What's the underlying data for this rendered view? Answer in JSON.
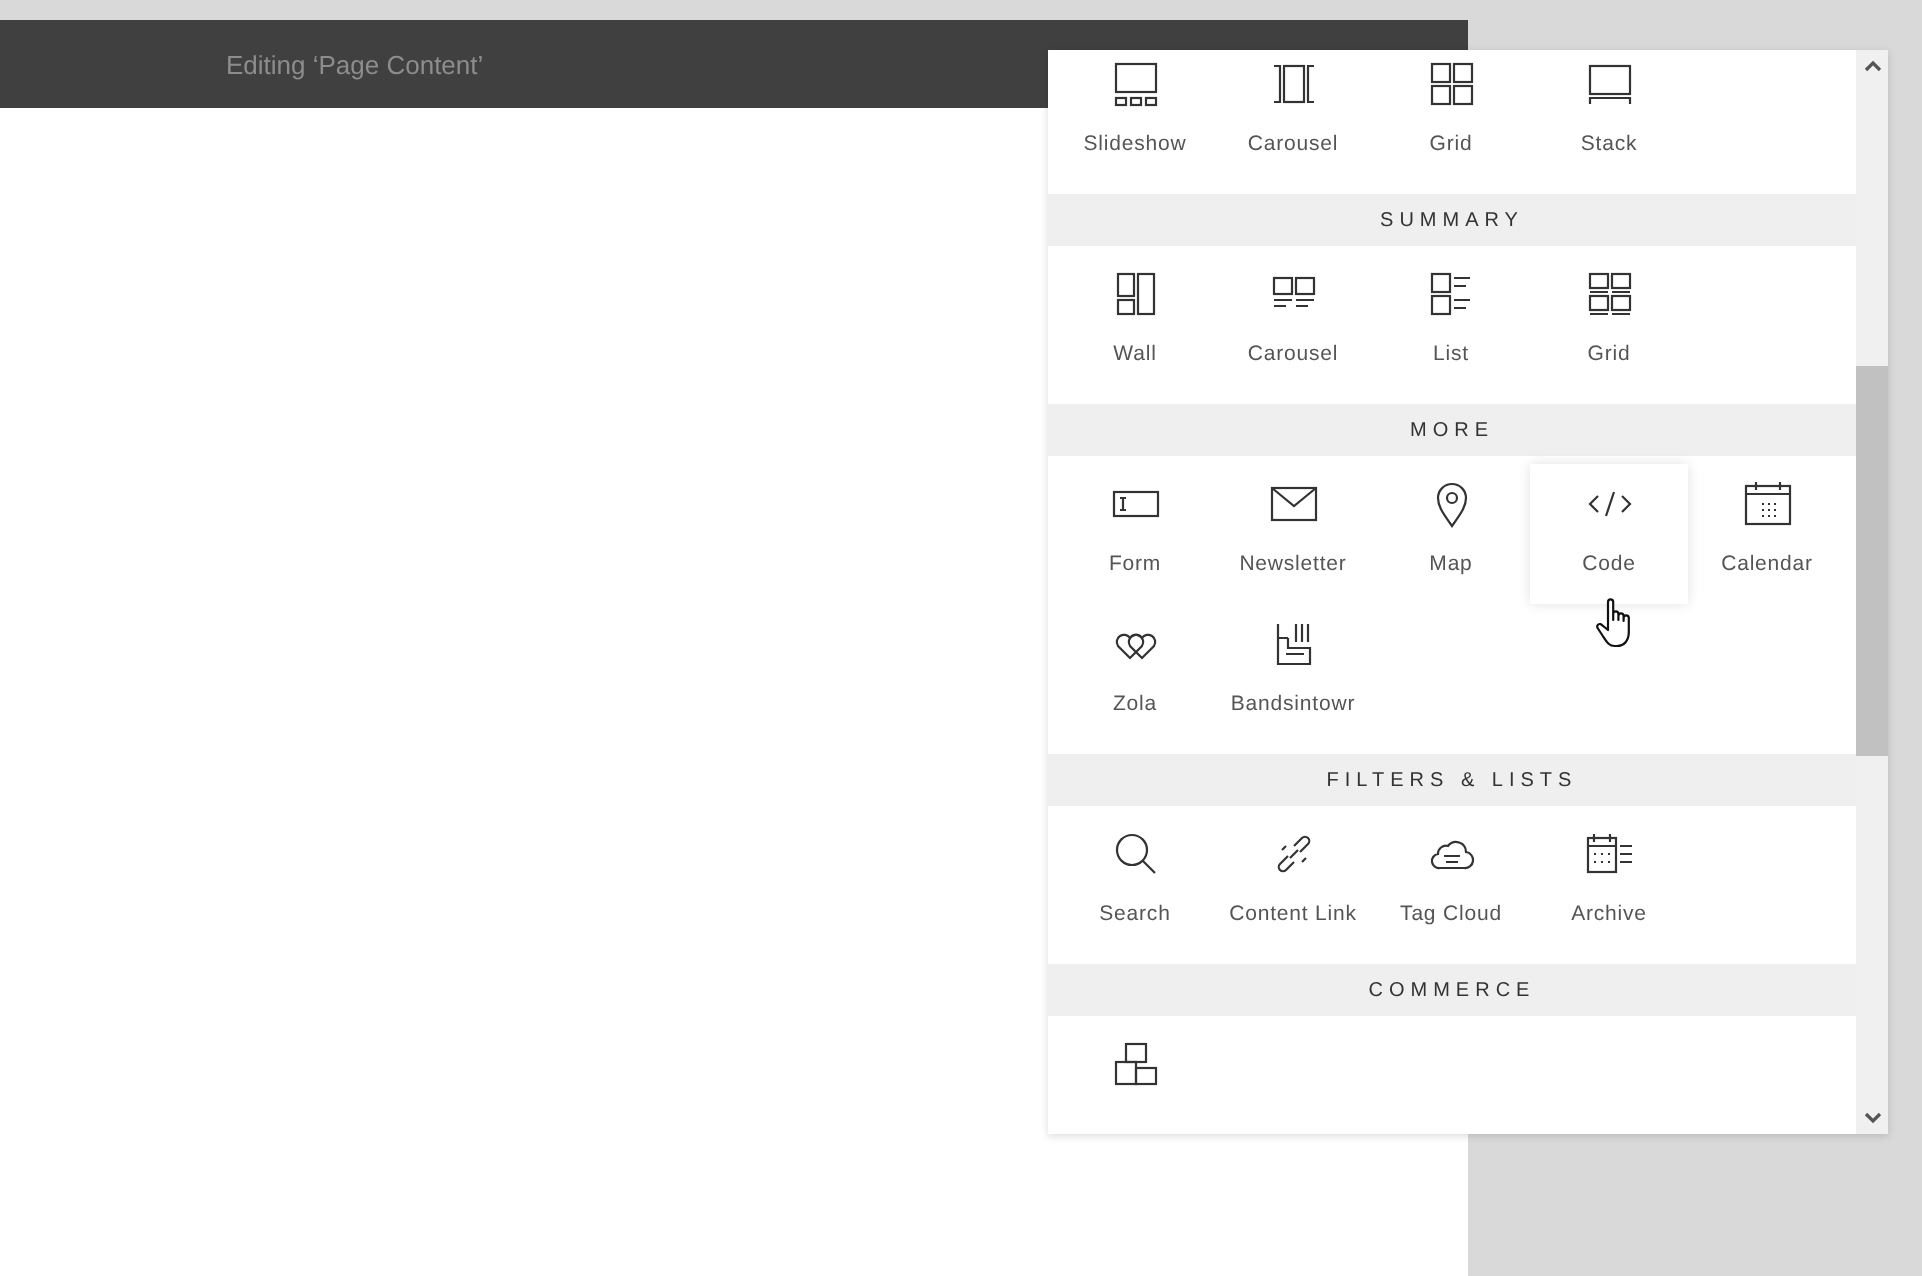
{
  "header": {
    "title": "Editing ‘Page Content’"
  },
  "sections": [
    {
      "items": [
        {
          "label": "Slideshow",
          "kind": "slideshow",
          "hovered": false
        },
        {
          "label": "Carousel",
          "kind": "carousel",
          "hovered": false
        },
        {
          "label": "Grid",
          "kind": "grid",
          "hovered": false
        },
        {
          "label": "Stack",
          "kind": "stack",
          "hovered": false
        }
      ]
    },
    {
      "title": "SUMMARY",
      "items": [
        {
          "label": "Wall",
          "kind": "wall",
          "hovered": false
        },
        {
          "label": "Carousel",
          "kind": "summary-carousel",
          "hovered": false
        },
        {
          "label": "List",
          "kind": "list",
          "hovered": false
        },
        {
          "label": "Grid",
          "kind": "summary-grid",
          "hovered": false
        }
      ]
    },
    {
      "title": "MORE",
      "items": [
        {
          "label": "Form",
          "kind": "form",
          "hovered": false
        },
        {
          "label": "Newsletter",
          "kind": "envelope",
          "hovered": false
        },
        {
          "label": "Map",
          "kind": "pin",
          "hovered": false
        },
        {
          "label": "Code",
          "kind": "code",
          "hovered": true
        },
        {
          "label": "Calendar",
          "kind": "calendar",
          "hovered": false
        },
        {
          "label": "Zola",
          "kind": "hearts",
          "hovered": false
        },
        {
          "label": "Bandsintowr",
          "kind": "bands",
          "hovered": false
        }
      ]
    },
    {
      "title": "FILTERS & LISTS",
      "items": [
        {
          "label": "Search",
          "kind": "search",
          "hovered": false
        },
        {
          "label": "Content Link",
          "kind": "link",
          "hovered": false
        },
        {
          "label": "Tag Cloud",
          "kind": "cloud",
          "hovered": false
        },
        {
          "label": "Archive",
          "kind": "archive",
          "hovered": false
        }
      ]
    },
    {
      "title": "COMMERCE",
      "items": [
        {
          "kind": "boxes",
          "hovered": false
        }
      ]
    }
  ]
}
